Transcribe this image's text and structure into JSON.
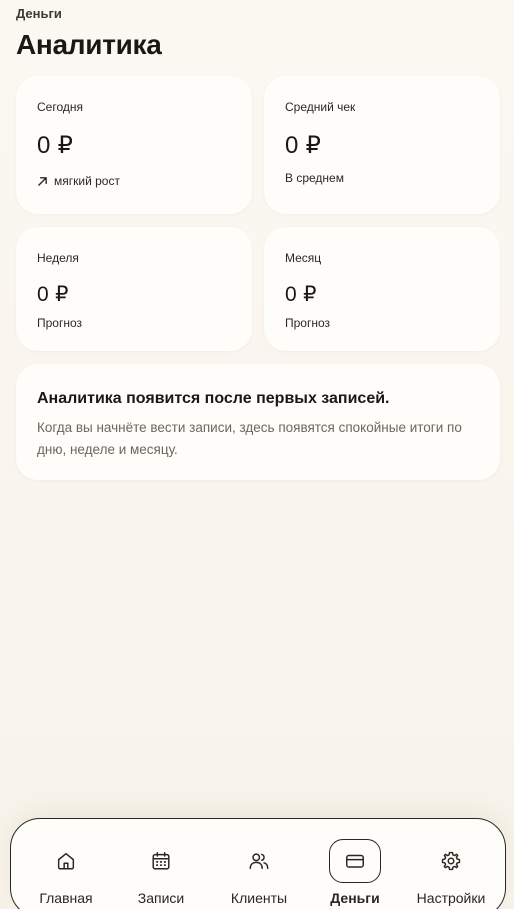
{
  "header": {
    "overline": "Деньги",
    "title": "Аналитика"
  },
  "cards": {
    "today": {
      "label": "Сегодня",
      "value": "0 ₽",
      "sub": "мягкий рост",
      "sub_icon": "trend-up-icon"
    },
    "avg_check": {
      "label": "Средний чек",
      "value": "0 ₽",
      "sub": "В среднем"
    },
    "week": {
      "label": "Неделя",
      "value": "0 ₽",
      "sub": "Прогноз"
    },
    "month": {
      "label": "Месяц",
      "value": "0 ₽",
      "sub": "Прогноз"
    }
  },
  "empty_state": {
    "title": "Аналитика появится после первых записей.",
    "text": "Когда вы начнёте вести записи, здесь появятся спокойные итоги по дню, неделе и месяцу."
  },
  "bottom_nav": {
    "items": [
      {
        "label": "Главная",
        "icon": "home-icon",
        "active": false
      },
      {
        "label": "Записи",
        "icon": "calendar-icon",
        "active": false
      },
      {
        "label": "Клиенты",
        "icon": "users-icon",
        "active": false
      },
      {
        "label": "Деньги",
        "icon": "wallet-card-icon",
        "active": true
      },
      {
        "label": "Настройки",
        "icon": "gear-icon",
        "active": false
      }
    ]
  },
  "colors": {
    "background": "#fbf8f2",
    "card": "#fffdf9",
    "text": "#1a1815",
    "muted_text": "#6b665e"
  }
}
